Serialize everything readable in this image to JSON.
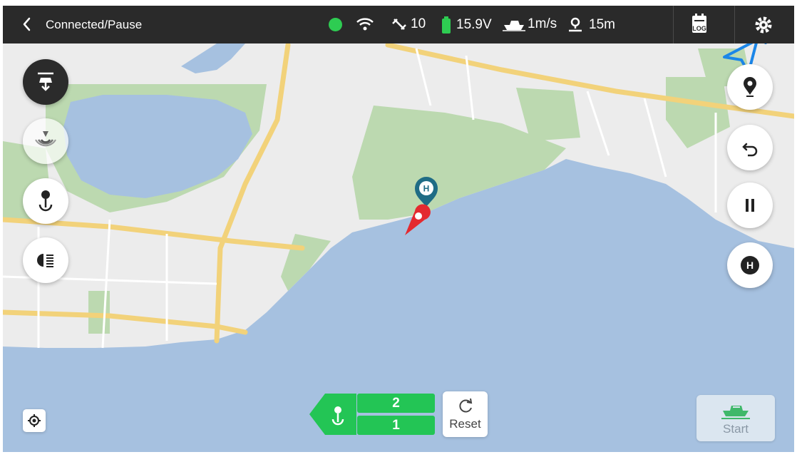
{
  "topbar": {
    "status_text": "Connected/Pause",
    "satellites": "10",
    "voltage": "15.9V",
    "speed": "1m/s",
    "distance": "15m",
    "log_label": "LOG",
    "connection_dot_color": "#2ecc52",
    "battery_color": "#2ecc52"
  },
  "left_tools": [
    "bait-drop-icon",
    "sonar-icon",
    "hook-icon",
    "headlight-icon"
  ],
  "right_tools": [
    "waypoint-icon",
    "return-icon",
    "pause-icon",
    "home-icon"
  ],
  "map": {
    "home_marker_label": "H",
    "home_button_label": "H",
    "water_color": "#a6c1e0",
    "land_color": "#ececec",
    "park_color": "#bcd9b0",
    "road_color": "#f2d27a"
  },
  "counter": {
    "top_value": "2",
    "bottom_value": "1",
    "accent_color": "#23c555"
  },
  "reset": {
    "label": "Reset"
  },
  "start": {
    "label": "Start"
  }
}
